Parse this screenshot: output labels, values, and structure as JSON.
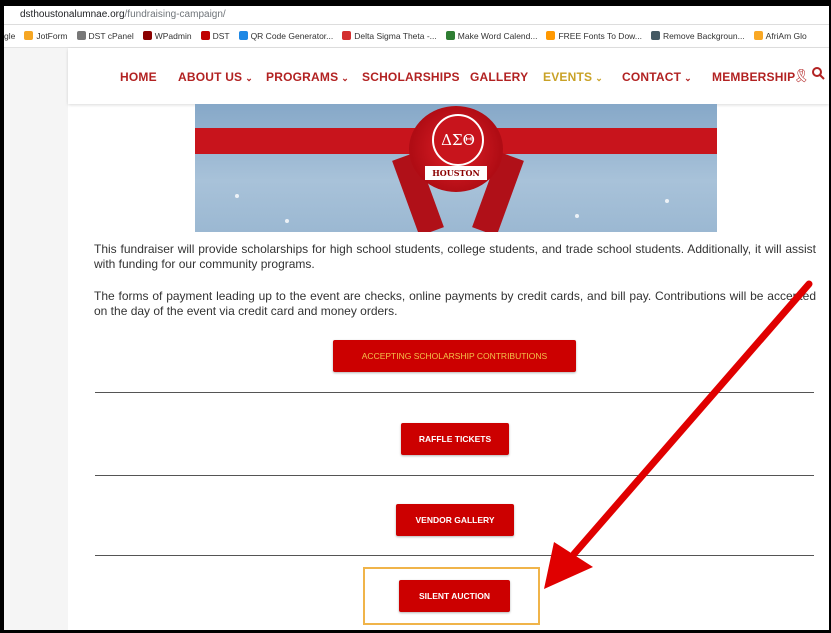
{
  "browser": {
    "url_host": "dsthoustonalumnae.org",
    "url_path": "/fundraising-campaign/",
    "bookmarks": [
      {
        "label": "gle",
        "color": "#ffffff"
      },
      {
        "label": "JotForm",
        "color": "#f6a623"
      },
      {
        "label": "DST cPanel",
        "color": "#777777"
      },
      {
        "label": "WPadmin",
        "color": "#8b0000"
      },
      {
        "label": "DST",
        "color": "#c00000"
      },
      {
        "label": "QR Code Generator...",
        "color": "#1e88e5"
      },
      {
        "label": "Delta Sigma Theta -...",
        "color": "#d32f2f"
      },
      {
        "label": "Make Word Calend...",
        "color": "#2e7d32"
      },
      {
        "label": "FREE Fonts To Dow...",
        "color": "#ff9800"
      },
      {
        "label": "Remove Backgroun...",
        "color": "#455a64"
      },
      {
        "label": "AfriAm Glo",
        "color": "#f9a825"
      }
    ]
  },
  "nav": {
    "items": [
      {
        "label": "HOME",
        "chevron": ""
      },
      {
        "label": "ABOUT US",
        "chevron": "⌄"
      },
      {
        "label": "PROGRAMS",
        "chevron": "⌄"
      },
      {
        "label": "SCHOLARSHIPS",
        "chevron": ""
      },
      {
        "label": "GALLERY",
        "chevron": ""
      },
      {
        "label": "EVENTS",
        "chevron": "⌄"
      },
      {
        "label": "CONTACT",
        "chevron": "⌄"
      },
      {
        "label": "MEMBERSHIP",
        "chevron": ""
      }
    ],
    "active_color": "#c9a227",
    "color": "#b22222"
  },
  "banner": {
    "seal_text": "ΔΣΘ",
    "seal_tag": "HOUSTON"
  },
  "content": {
    "para1": "This fundraiser will provide scholarships for high school students, college students, and trade school students. Additionally, it will assist with funding for our community programs.",
    "para2": "The forms of payment leading up to the event are checks, online payments by credit cards, and bill pay. Contributions will be accepted on the day of the event via credit card and money orders."
  },
  "buttons": {
    "scholarship": "ACCEPTING SCHOLARSHIP CONTRIBUTIONS",
    "raffle": "RAFFLE TICKETS",
    "vendor": "VENDOR GALLERY",
    "auction": "SILENT AUCTION"
  },
  "colors": {
    "button_red": "#cc0000",
    "highlight": "#f0b44a",
    "arrow": "#e00000"
  }
}
